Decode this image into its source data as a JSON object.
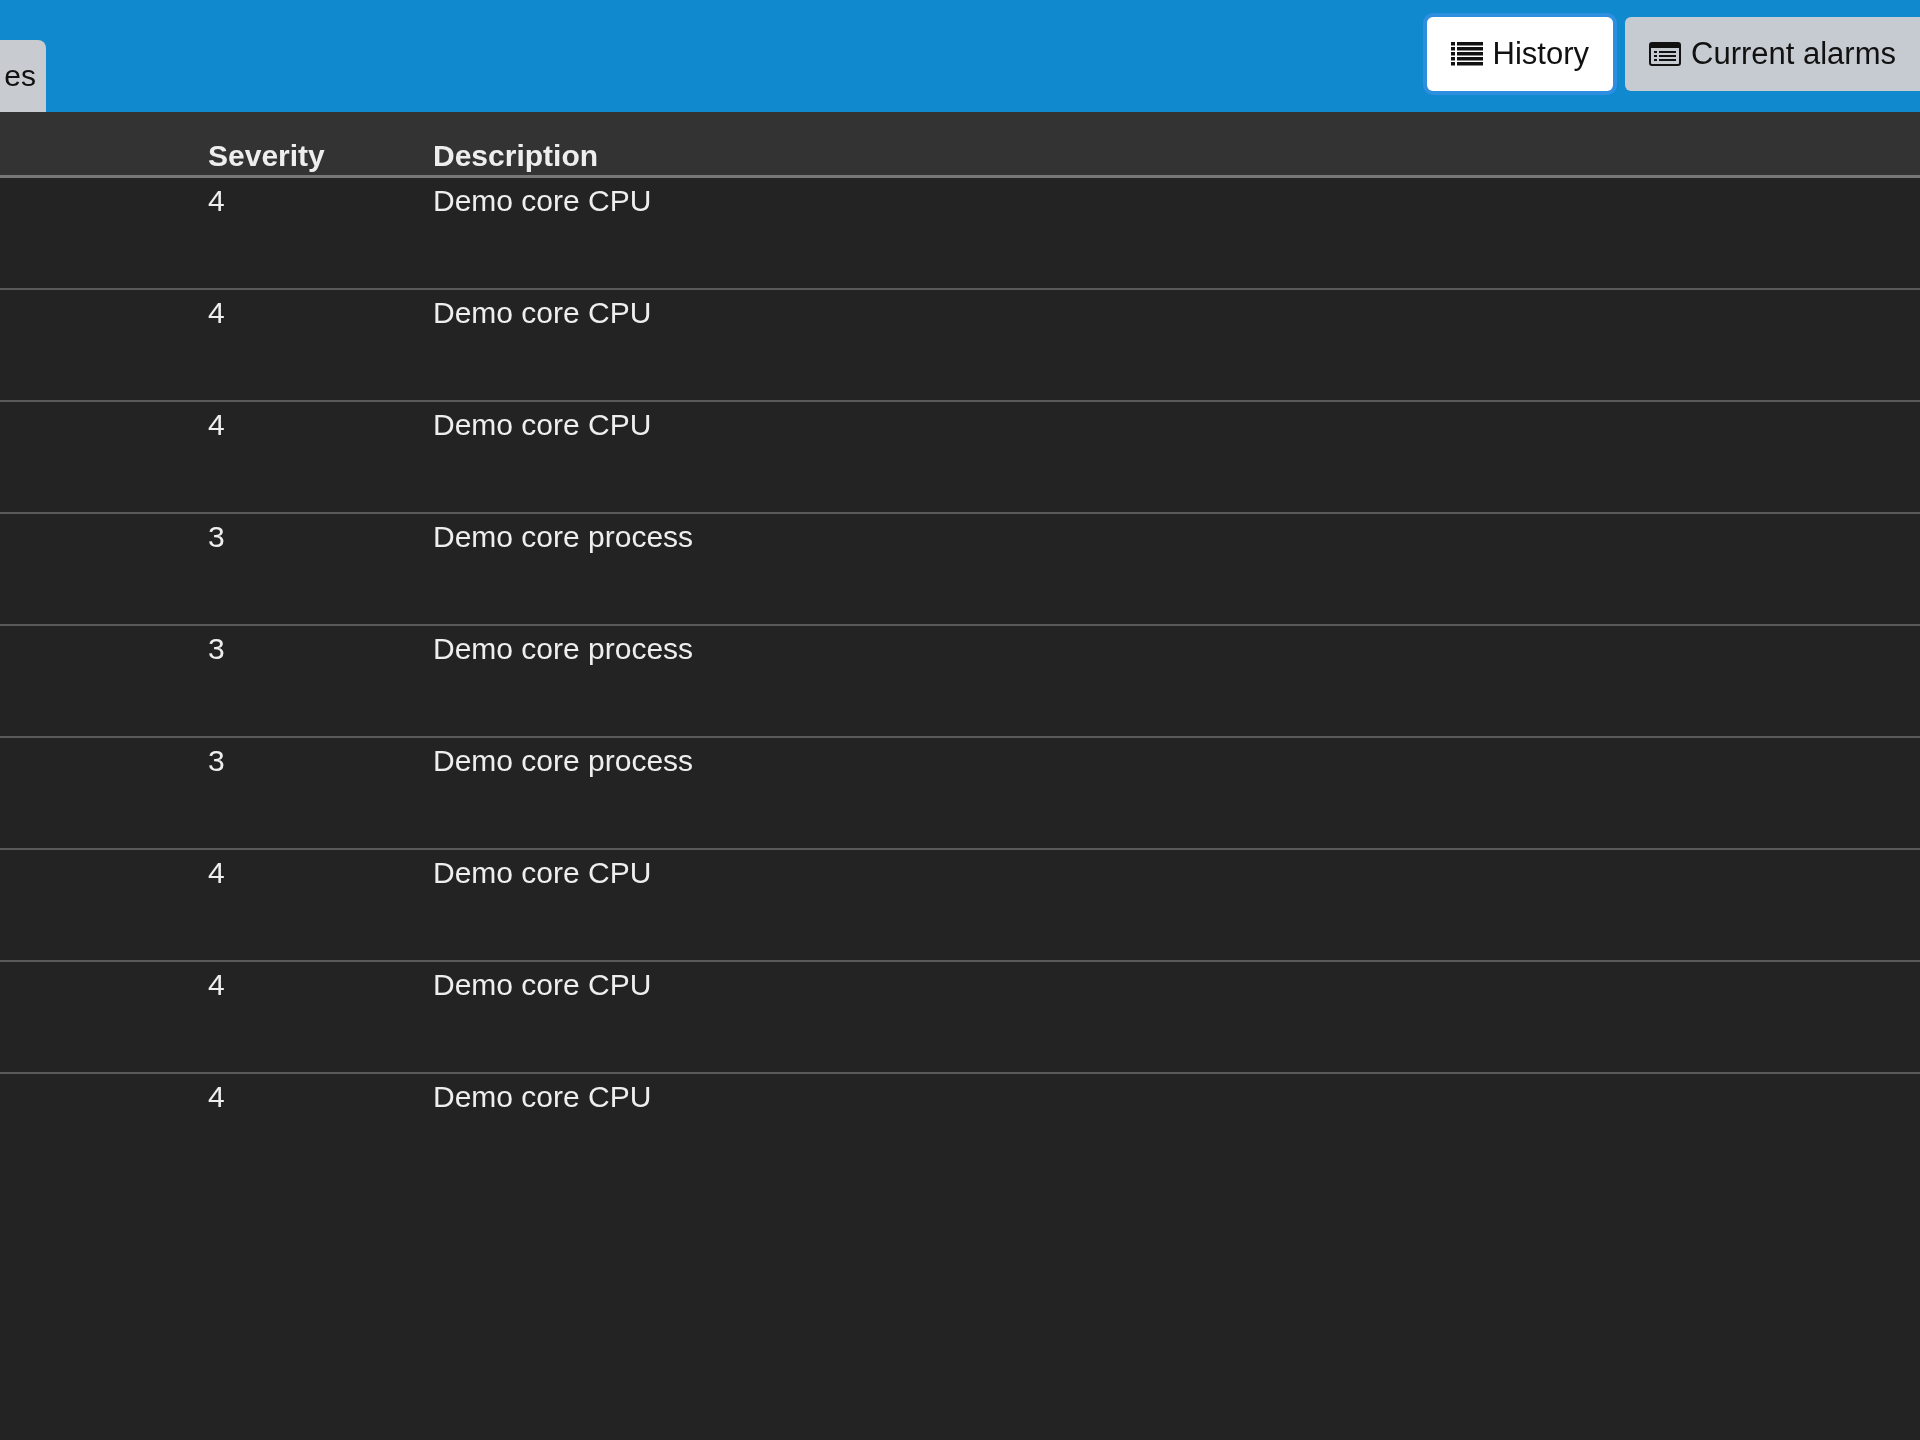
{
  "top_bar": {
    "tab": {
      "label": "es"
    },
    "view_buttons": [
      {
        "label": "History",
        "kind": "list",
        "selected": true
      },
      {
        "label": "Current alarms",
        "kind": "table",
        "selected": false
      }
    ]
  },
  "table": {
    "columns": [
      "Severity",
      "Description"
    ],
    "rows": [
      {
        "severity": "4",
        "description": "Demo core CPU"
      },
      {
        "severity": "4",
        "description": "Demo core CPU"
      },
      {
        "severity": "4",
        "description": "Demo core CPU"
      },
      {
        "severity": "3",
        "description": "Demo core process"
      },
      {
        "severity": "3",
        "description": "Demo core process"
      },
      {
        "severity": "3",
        "description": "Demo core process"
      },
      {
        "severity": "4",
        "description": "Demo core CPU"
      },
      {
        "severity": "4",
        "description": "Demo core CPU"
      },
      {
        "severity": "4",
        "description": "Demo core CPU"
      }
    ]
  }
}
